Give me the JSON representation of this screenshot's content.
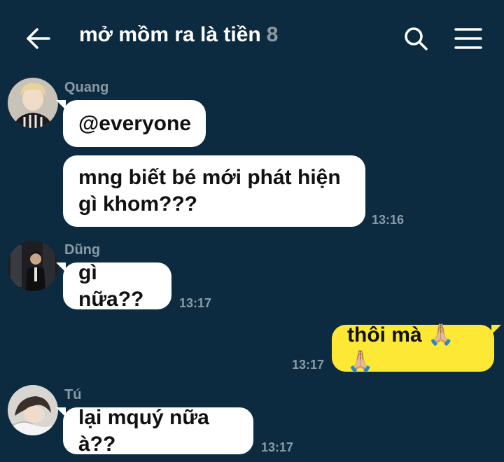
{
  "header": {
    "title": "mở mồm ra là tiền",
    "member_count": "8",
    "icons": {
      "back": "arrow-left-icon",
      "search": "search-icon",
      "menu": "hamburger-menu-icon"
    }
  },
  "colors": {
    "background": "#0d2b40",
    "incoming_bubble": "#ffffff",
    "outgoing_bubble": "#fde835",
    "muted_text": "#8a9aa6"
  },
  "messages": [
    {
      "sender": "Quang",
      "text": "@everyone",
      "time": ""
    },
    {
      "sender": "Quang",
      "text": "mng biết bé mới phát hiện\ngì khom???",
      "time": "13:16"
    },
    {
      "sender": "Dũng",
      "text": "gì nữa??",
      "time": "13:17"
    },
    {
      "sender": "me",
      "text": "thôi mà 🙏🏼🙏🏼",
      "time": "13:17"
    },
    {
      "sender": "Tú",
      "text": "lại mquý nữa à??",
      "time": "13:17"
    }
  ]
}
